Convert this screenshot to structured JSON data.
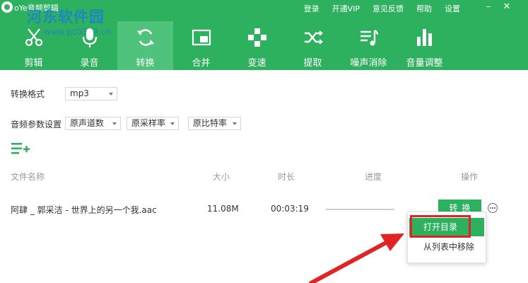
{
  "titlebar": {
    "app_title": "oYe音频剪辑",
    "watermark_title": "河东软件园",
    "watermark_url": "www.pc0359.cn",
    "links": [
      "登录",
      "开通VIP",
      "意见反馈",
      "帮助",
      "设置"
    ],
    "minimize_glyph": "–",
    "close_glyph": "✕"
  },
  "toolbar": {
    "tools": [
      {
        "label": "剪辑",
        "icon": "scissors-icon"
      },
      {
        "label": "录音",
        "icon": "microphone-icon"
      },
      {
        "label": "转换",
        "icon": "convert-icon",
        "active": true
      },
      {
        "label": "合并",
        "icon": "merge-icon"
      },
      {
        "label": "变速",
        "icon": "speed-icon"
      },
      {
        "label": "提取",
        "icon": "shuffle-icon"
      },
      {
        "label": "噪声消除",
        "icon": "noise-icon"
      },
      {
        "label": "音量调整",
        "icon": "volume-bars-icon"
      }
    ]
  },
  "settings": {
    "format_label": "转换格式",
    "format_value": "mp3",
    "params_label": "音频参数设置",
    "channel_value": "原声道数",
    "samplerate_value": "原采样率",
    "bitrate_value": "原比特率"
  },
  "table": {
    "headers": [
      "文件名称",
      "大小",
      "时长",
      "进度",
      "操作"
    ],
    "rows": [
      {
        "name": "阿肆 _ 郭采洁 - 世界上的另一个我.aac",
        "size": "11.08M",
        "duration": "00:03:19",
        "action": "转换"
      }
    ]
  },
  "context_menu": {
    "items": [
      "打开目录",
      "从列表中移除"
    ]
  },
  "colors": {
    "brand_green": "#2eb15f",
    "active_tab": "#4fc37c",
    "annotation_red": "#e02424",
    "watermark_blue": "#1d7fd0"
  }
}
